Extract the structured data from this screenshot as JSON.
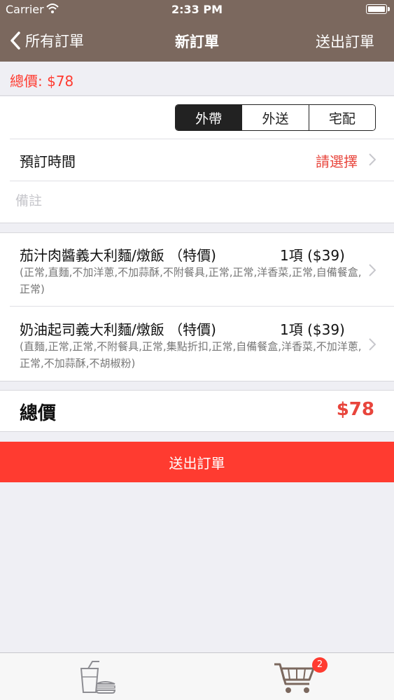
{
  "status_bar": {
    "carrier": "Carrier",
    "time": "2:33 PM",
    "wifi_icon": "wifi-icon",
    "battery_icon": "battery-icon"
  },
  "nav": {
    "back_label": "所有訂單",
    "title": "新訂單",
    "right_label": "送出訂單"
  },
  "summary": {
    "total_text": "總價: $78"
  },
  "delivery": {
    "options": [
      "外帶",
      "外送",
      "宅配"
    ],
    "selected": "外帶"
  },
  "reserve_time": {
    "label": "預訂時間",
    "value": "請選擇"
  },
  "note": {
    "placeholder": "備註",
    "value": ""
  },
  "items": [
    {
      "name": "茄汁肉醬義大利麵/燉飯 （特價)",
      "qty": "1項 ($39)",
      "options": "(正常,直麵,不加洋蔥,不加蒜酥,不附餐具,正常,正常,洋香菜,正常,自備餐盒,正常)"
    },
    {
      "name": "奶油起司義大利麵/燉飯 （特價)",
      "qty": "1項 ($39)",
      "options": "(直麵,正常,正常,不附餐具,正常,集點折扣,正常,自備餐盒,洋香菜,不加洋蔥,正常,不加蒜酥,不胡椒粉)"
    }
  ],
  "grand_total": {
    "label": "總價",
    "value": "$78"
  },
  "submit": {
    "label": "送出訂單"
  },
  "tab_bar": {
    "tabs": [
      {
        "icon": "drink-burger-icon"
      },
      {
        "icon": "cart-icon",
        "badge": "2"
      }
    ]
  },
  "colors": {
    "nav_bg": "#7b685e",
    "accent_red": "#ff3b30",
    "price_red": "#e8453c",
    "background": "#efeff4"
  }
}
